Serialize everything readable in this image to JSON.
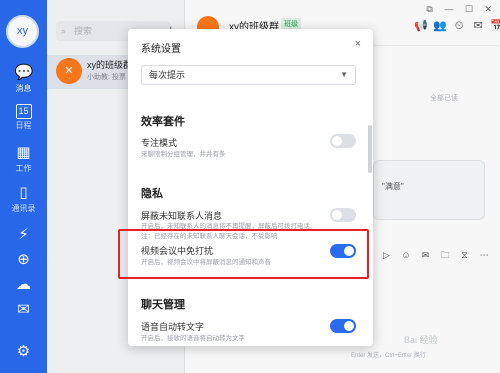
{
  "rail": {
    "avatar": "xy",
    "items": [
      {
        "icon": "💬",
        "label": "消息"
      },
      {
        "icon": "15",
        "label": "日程"
      },
      {
        "icon": "▦",
        "label": "工作"
      },
      {
        "icon": "▯",
        "label": "通讯录"
      },
      {
        "icon": "⚡",
        "label": ""
      },
      {
        "icon": "⊕",
        "label": ""
      },
      {
        "icon": "☁",
        "label": ""
      },
      {
        "icon": "✉",
        "label": ""
      },
      {
        "icon": "⚙",
        "label": ""
      }
    ]
  },
  "convlist": {
    "search_placeholder": "搜索",
    "plus": "+",
    "items": [
      {
        "avatar": "✕",
        "name": "xy的班级群",
        "preview": "小助教: 投票"
      }
    ]
  },
  "chat": {
    "title": "xy的班级群",
    "tag": "班级",
    "header_icons": [
      "📢",
      "👥",
      "⏲",
      "✉",
      "📅"
    ],
    "window_controls": [
      "⧉",
      "—",
      "☐",
      "✕"
    ],
    "read_mark": "全部已读",
    "bubble_text": "\"满意\"",
    "input_icons": [
      "▷",
      "☺",
      "✉",
      "🗀",
      "⧖",
      "⋯"
    ],
    "send_hint": "Enter 发送，Ctrl+Enter 换行"
  },
  "dialog": {
    "title": "系统设置",
    "close": "×",
    "select_value": "每次提示",
    "section_efficiency": "效率套件",
    "focus_label": "专注模式",
    "focus_desc": "来聊限制分组管理，井井有条",
    "focus_on": false,
    "section_privacy": "隐私",
    "block_label": "屏蔽未知联系人消息",
    "block_desc": "开启后，未知联系人的消息将不再提醒，屏蔽后可拨打电话。注：已经存在的未知联系人聊天会话，不受影响",
    "block_on": false,
    "meeting_label": "视频会议中免打扰",
    "meeting_desc": "开启后，视频会议中将屏蔽消息的通知和声音",
    "meeting_on": true,
    "section_chat": "聊天管理",
    "voice_label": "语音自动转文字",
    "voice_desc": "开启后，接收的语音将自动转为文字",
    "voice_on": true
  },
  "watermark": "Bai 经验",
  "colors": {
    "brand": "#2a6bf0",
    "highlight": "#e8202a",
    "toggle_off": "#dcdfe4"
  }
}
